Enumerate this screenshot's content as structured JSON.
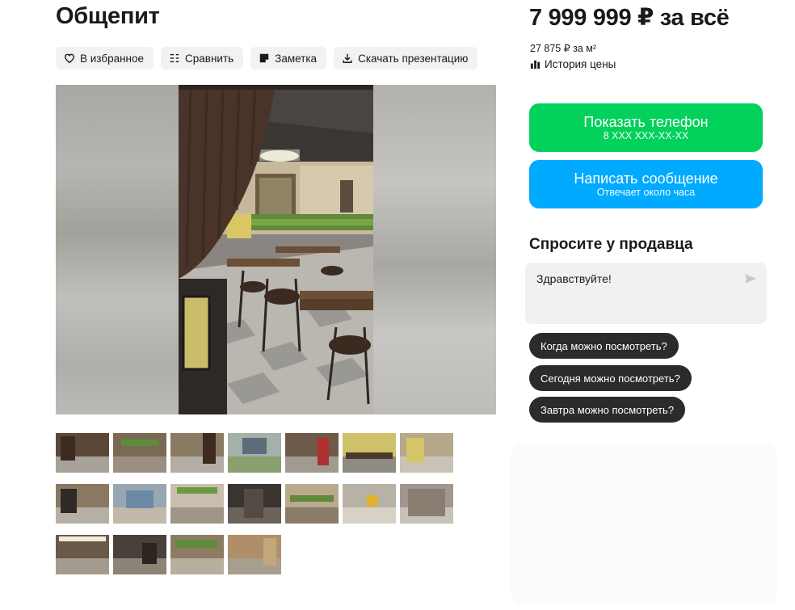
{
  "listing": {
    "title": "Общепит"
  },
  "actions": [
    {
      "label": "В избранное",
      "icon": "heart-icon"
    },
    {
      "label": "Сравнить",
      "icon": "compare-icon"
    },
    {
      "label": "Заметка",
      "icon": "note-icon"
    },
    {
      "label": "Скачать презентацию",
      "icon": "download-icon"
    }
  ],
  "price": {
    "total": "7 999 999 ₽ за всё",
    "per_m2": "27 875 ₽ за м²",
    "history_label": "История цены"
  },
  "contact": {
    "phone_label": "Показать телефон",
    "phone_masked": "8 XXX XXX-XX-XX",
    "message_label": "Написать сообщение",
    "message_sub": "Отвечает около часа"
  },
  "ask": {
    "title": "Спросите у продавца",
    "input_value": "Здравствуйте!",
    "quick_replies": [
      "Когда можно посмотреть?",
      "Сегодня можно посмотреть?",
      "Завтра можно посмотреть?"
    ]
  },
  "gallery": {
    "selected_index": 0,
    "thumb_count": 18
  },
  "colors": {
    "phone_button": "#02d15c",
    "message_button": "#00aaff",
    "chip_dark": "#2b2b2b",
    "selected_thumb_border": "#2f8fd8"
  }
}
